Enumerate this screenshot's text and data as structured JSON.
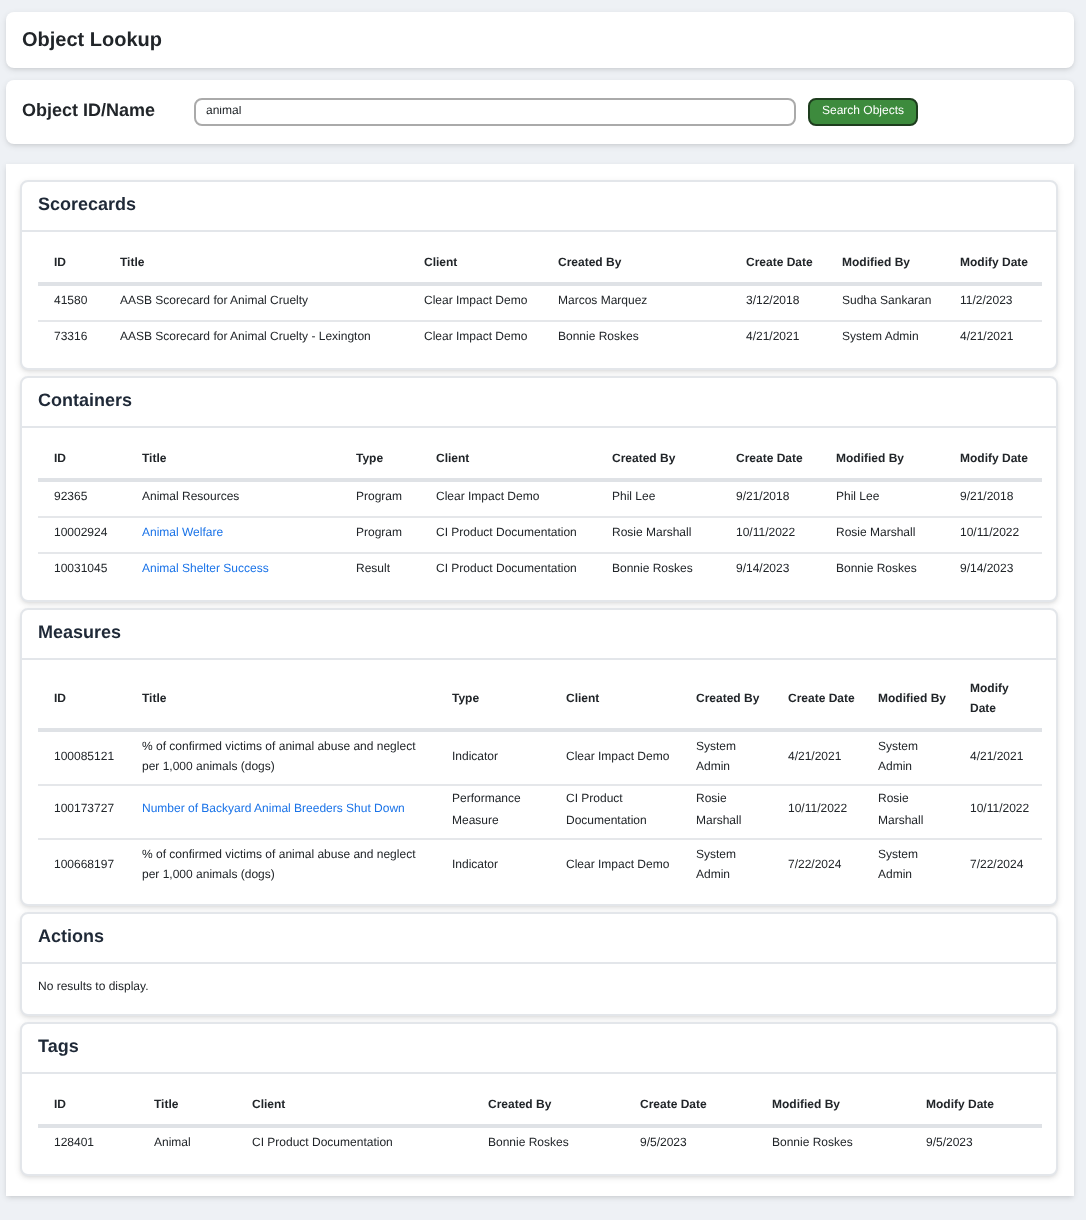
{
  "page_title": "Object Lookup",
  "search": {
    "label": "Object ID/Name",
    "value": "animal",
    "button": "Search Objects"
  },
  "sections": [
    {
      "title": "Scorecards",
      "kind": "table",
      "columns": [
        "ID",
        "Title",
        "Client",
        "Created By",
        "Create Date",
        "Modified By",
        "Modify Date"
      ],
      "rows": [
        {
          "cells": [
            "41580",
            "AASB Scorecard for Animal Cruelty",
            "Clear Impact Demo",
            "Marcos Marquez",
            "3/12/2018",
            "Sudha Sankaran",
            "11/2/2023"
          ],
          "title_link": false
        },
        {
          "cells": [
            "73316",
            "AASB Scorecard for Animal Cruelty - Lexington",
            "Clear Impact Demo",
            "Bonnie Roskes",
            "4/21/2021",
            "System Admin",
            "4/21/2021"
          ],
          "title_link": false
        }
      ]
    },
    {
      "title": "Containers",
      "kind": "table",
      "columns": [
        "ID",
        "Title",
        "Type",
        "Client",
        "Created By",
        "Create Date",
        "Modified By",
        "Modify Date"
      ],
      "rows": [
        {
          "cells": [
            "92365",
            "Animal Resources",
            "Program",
            "Clear Impact Demo",
            "Phil Lee",
            "9/21/2018",
            "Phil Lee",
            "9/21/2018"
          ],
          "title_link": false
        },
        {
          "cells": [
            "10002924",
            "Animal Welfare",
            "Program",
            "CI Product Documentation",
            "Rosie Marshall",
            "10/11/2022",
            "Rosie Marshall",
            "10/11/2022"
          ],
          "title_link": true
        },
        {
          "cells": [
            "10031045",
            "Animal Shelter Success",
            "Result",
            "CI Product Documentation",
            "Bonnie Roskes",
            "9/14/2023",
            "Bonnie Roskes",
            "9/14/2023"
          ],
          "title_link": true
        }
      ]
    },
    {
      "title": "Measures",
      "kind": "table",
      "columns": [
        "ID",
        "Title",
        "Type",
        "Client",
        "Created By",
        "Create Date",
        "Modified By",
        "Modify Date"
      ],
      "rows": [
        {
          "cells": [
            "100085121",
            "% of confirmed victims of animal abuse and neglect per 1,000 animals (dogs)",
            "Indicator",
            "Clear Impact Demo",
            "System Admin",
            "4/21/2021",
            "System Admin",
            "4/21/2021"
          ],
          "title_link": false
        },
        {
          "cells": [
            "100173727",
            "Number of Backyard Animal Breeders Shut Down",
            "Performance Measure",
            "CI Product Documentation",
            "Rosie Marshall",
            "10/11/2022",
            "Rosie Marshall",
            "10/11/2022"
          ],
          "title_link": true
        },
        {
          "cells": [
            "100668197",
            "% of confirmed victims of animal abuse and neglect per 1,000 animals (dogs)",
            "Indicator",
            "Clear Impact Demo",
            "System Admin",
            "7/22/2024",
            "System Admin",
            "7/22/2024"
          ],
          "title_link": false
        }
      ]
    },
    {
      "title": "Actions",
      "kind": "empty",
      "message": "No results to display."
    },
    {
      "title": "Tags",
      "kind": "table",
      "columns": [
        "ID",
        "Title",
        "Client",
        "Created By",
        "Create Date",
        "Modified By",
        "Modify Date"
      ],
      "rows": [
        {
          "cells": [
            "128401",
            "Animal",
            "CI Product Documentation",
            "Bonnie Roskes",
            "9/5/2023",
            "Bonnie Roskes",
            "9/5/2023"
          ],
          "title_link": false
        }
      ]
    }
  ]
}
